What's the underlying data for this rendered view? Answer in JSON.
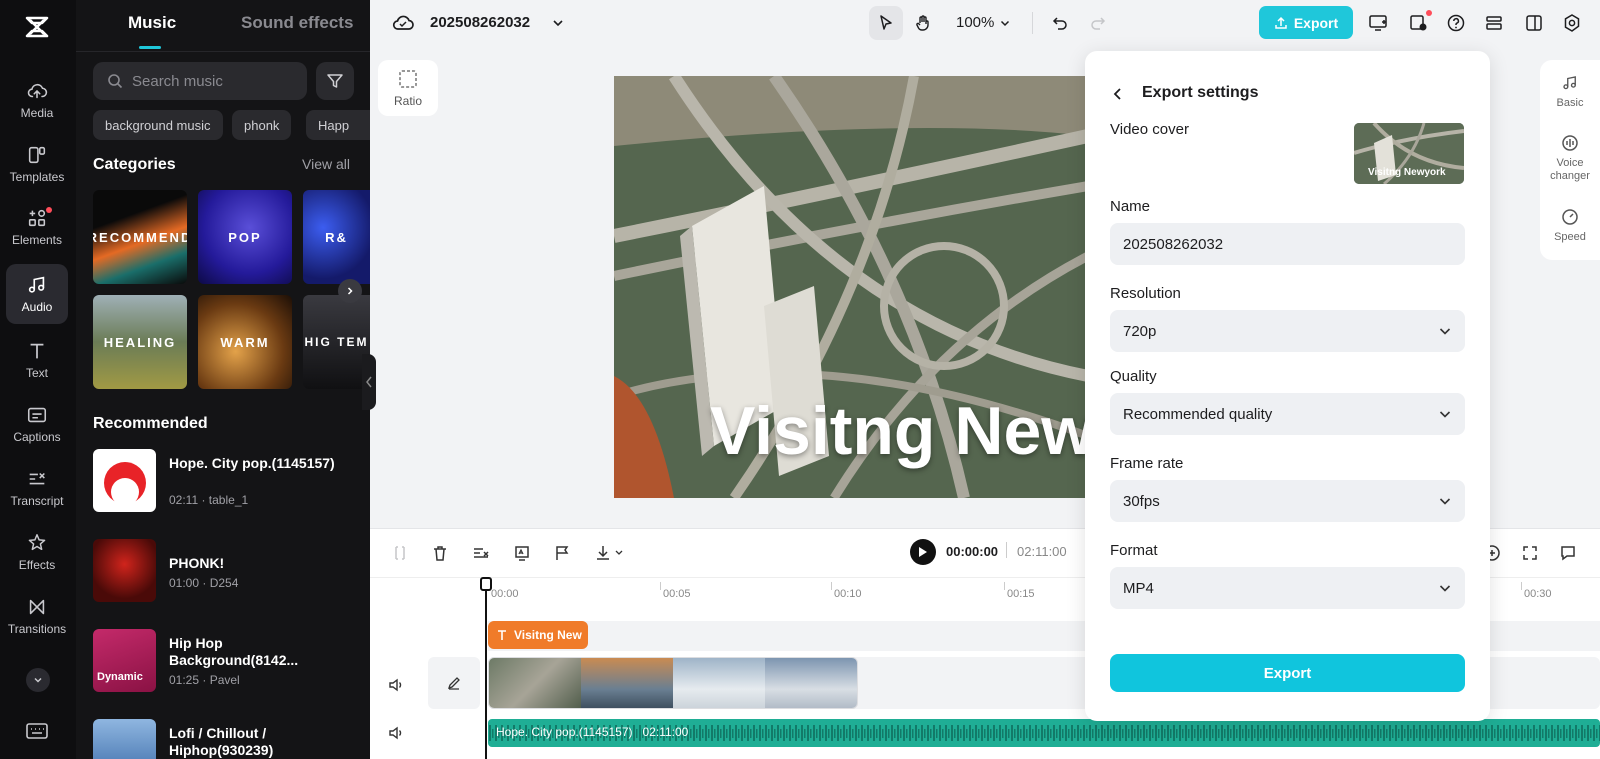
{
  "rail": {
    "items": [
      {
        "label": "Media"
      },
      {
        "label": "Templates"
      },
      {
        "label": "Elements"
      },
      {
        "label": "Audio"
      },
      {
        "label": "Text"
      },
      {
        "label": "Captions"
      },
      {
        "label": "Transcript"
      },
      {
        "label": "Effects"
      },
      {
        "label": "Transitions"
      }
    ]
  },
  "panel": {
    "tabs": [
      {
        "label": "Music"
      },
      {
        "label": "Sound effects"
      }
    ],
    "search_placeholder": "Search music",
    "chips": [
      "background music",
      "phonk",
      "Happ"
    ],
    "categories_title": "Categories",
    "view_all": "View all",
    "categories": [
      {
        "label": "RECOMMEND"
      },
      {
        "label": "POP"
      },
      {
        "label": "R&"
      },
      {
        "label": "HEALING"
      },
      {
        "label": "WARM"
      },
      {
        "label": "HIG TEM"
      }
    ],
    "recommended_title": "Recommended",
    "songs": [
      {
        "title": "Hope. City pop.(1145157)",
        "meta": "02:11 · table_1"
      },
      {
        "title": "PHONK!",
        "meta": "01:00 · D254"
      },
      {
        "title": "Hip Hop Background(8142...",
        "meta": "01:25 · Pavel",
        "thumb_label": "Dynamic"
      },
      {
        "title": "Lofi / Chillout / Hiphop(930239)",
        "meta": ""
      }
    ]
  },
  "topbar": {
    "project_name": "202508262032",
    "zoom": "100%",
    "export_label": "Export"
  },
  "ratio_label": "Ratio",
  "preview": {
    "overlay_text": "Visitng New"
  },
  "props": [
    {
      "label": "Basic"
    },
    {
      "label": "Voice changer"
    },
    {
      "label": "Speed"
    }
  ],
  "timeline": {
    "current_time": "00:00:00",
    "total_time": "02:11:00",
    "ruler": [
      "00:00",
      "00:05",
      "00:10",
      "00:15",
      "00:30"
    ],
    "text_clip": "Visitng New",
    "audio_clip": {
      "name": "Hope. City pop.(1145157)",
      "duration": "02:11:00"
    }
  },
  "export_settings": {
    "title": "Export settings",
    "video_cover_label": "Video cover",
    "cover_text": "Visitng Newyork",
    "name_label": "Name",
    "name_value": "202508262032",
    "resolution_label": "Resolution",
    "resolution_value": "720p",
    "quality_label": "Quality",
    "quality_value": "Recommended quality",
    "framerate_label": "Frame rate",
    "framerate_value": "30fps",
    "format_label": "Format",
    "format_value": "MP4",
    "export_button": "Export"
  },
  "colors": {
    "accent": "#1fc7da",
    "text_clip": "#f07b29",
    "audio_clip": "#1fae95"
  }
}
